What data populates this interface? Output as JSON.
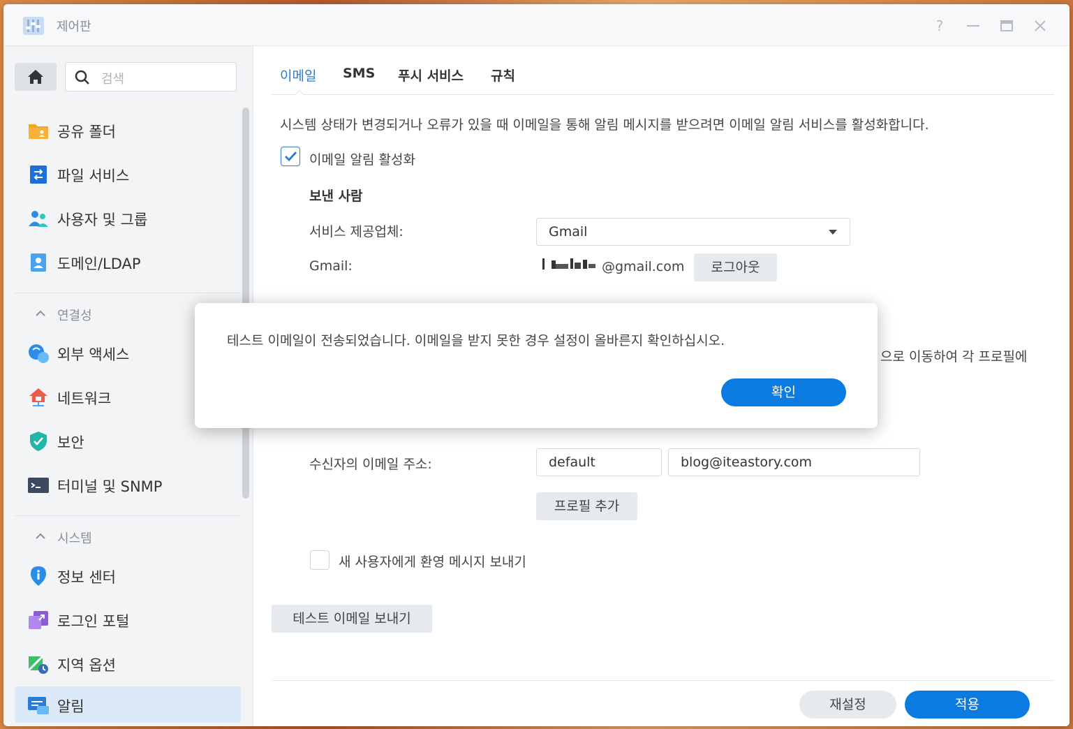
{
  "window": {
    "title": "제어판",
    "help_label": "?"
  },
  "sidebar": {
    "search_placeholder": "검색",
    "items_top": [
      {
        "label": "공유 폴더",
        "icon": "shared-folder-icon"
      },
      {
        "label": "파일 서비스",
        "icon": "file-services-icon"
      },
      {
        "label": "사용자 및 그룹",
        "icon": "users-groups-icon"
      },
      {
        "label": "도메인/LDAP",
        "icon": "domain-ldap-icon"
      }
    ],
    "section_connectivity": "연결성",
    "items_connectivity": [
      {
        "label": "외부 액세스",
        "icon": "external-access-icon"
      },
      {
        "label": "네트워크",
        "icon": "network-icon"
      },
      {
        "label": "보안",
        "icon": "security-shield-icon"
      },
      {
        "label": "터미널 및 SNMP",
        "icon": "terminal-icon"
      }
    ],
    "section_system": "시스템",
    "items_system": [
      {
        "label": "정보 센터",
        "icon": "info-center-icon"
      },
      {
        "label": "로그인 포털",
        "icon": "login-portal-icon"
      },
      {
        "label": "지역 옵션",
        "icon": "regional-options-icon"
      },
      {
        "label": "알림",
        "icon": "notification-icon",
        "active": true
      }
    ]
  },
  "tabs": [
    "이메일",
    "SMS",
    "푸시 서비스",
    "규칙"
  ],
  "email": {
    "description": "시스템 상태가 변경되거나 오류가 있을 때 이메일을 통해 알림 메시지를 받으려면 이메일 알림 서비스를 활성화합니다.",
    "enable_label": "이메일 알림 활성화",
    "enable_checked": true,
    "sender_heading": "보낸 사람",
    "provider_label": "서비스 제공업체:",
    "provider_value": "Gmail",
    "gmail_label": "Gmail:",
    "gmail_suffix": "@gmail.com",
    "logout_label": "로그아웃",
    "hidden_text_fragment": "으로 이동하여 각 프로필에",
    "recipient_label": "수신자의 이메일 주소:",
    "profile_value": "default",
    "recipient_email": "blog@iteastory.com",
    "add_profile_label": "프로필 추가",
    "welcome_label": "새 사용자에게 환영 메시지 보내기",
    "welcome_checked": false,
    "test_email_label": "테스트 이메일 보내기"
  },
  "footer": {
    "reset_label": "재설정",
    "apply_label": "적용"
  },
  "dialog": {
    "message": "테스트 이메일이 전송되었습니다. 이메일을 받지 못한 경우 설정이 올바른지 확인하십시오.",
    "ok_label": "확인"
  },
  "colors": {
    "accent": "#0b7ae1",
    "active_tab": "#2a7bd5",
    "sidebar_active": "#dbe9f9"
  }
}
